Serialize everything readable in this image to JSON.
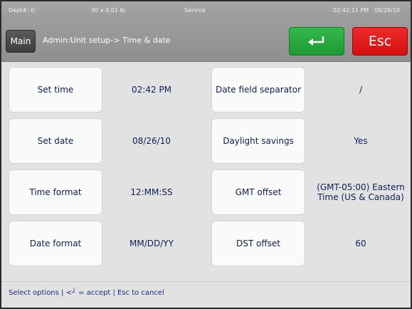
{
  "status_bar": {
    "dept": "Dept#: 0:",
    "scale": "30 x 0.01 lb",
    "mode": "Service",
    "time": "02:42:11 PM",
    "date": "08/26/10"
  },
  "header": {
    "main_label": "Main",
    "breadcrumb": "Admin:Unit setup-> Time & date",
    "enter_icon": "enter-arrow-icon",
    "esc_label": "Esc",
    "colors": {
      "enter": "#22a23a",
      "esc": "#e01818"
    }
  },
  "options": [
    {
      "label": "Set time",
      "value": "02:42 PM"
    },
    {
      "label": "Set date",
      "value": "08/26/10"
    },
    {
      "label": "Time format",
      "value": "12:MM:SS"
    },
    {
      "label": "Date format",
      "value": "MM/DD/YY"
    },
    {
      "label": "Date field separator",
      "value": "/"
    },
    {
      "label": "Daylight savings",
      "value": "Yes"
    },
    {
      "label": "GMT offset",
      "value": "(GMT-05:00) Eastern Time (US & Canada)"
    },
    {
      "label": "DST offset",
      "value": "60"
    }
  ],
  "footer": {
    "hint": "Select options | <┘ = accept | Esc to cancel"
  }
}
